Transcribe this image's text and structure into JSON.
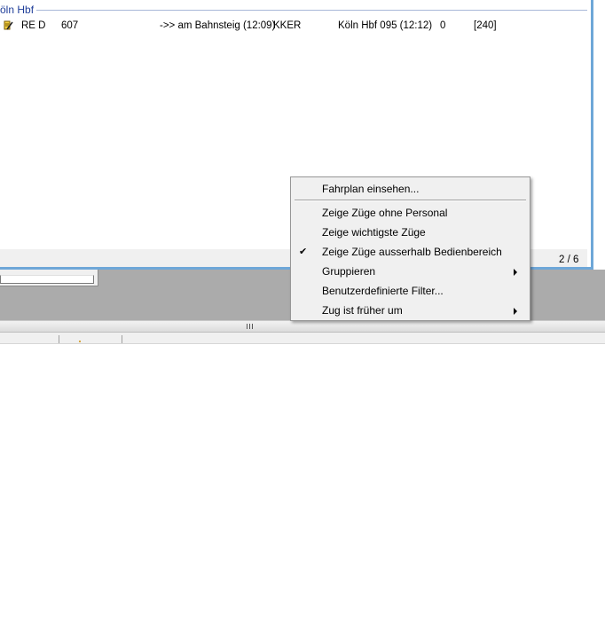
{
  "group": {
    "title": "öln Hbf"
  },
  "train_row": {
    "icon": "train-pencil-icon",
    "type": "RE D",
    "number": "607",
    "status": "->> am Bahnsteig (12:09)",
    "operator": "KKER",
    "destination": "Köln Hbf 095 (12:12)",
    "delay": "0",
    "track": "[240]"
  },
  "pager": {
    "text": "2 / 6"
  },
  "context_menu": {
    "items": [
      {
        "label": "Fahrplan einsehen...",
        "checked": false,
        "submenu": false
      },
      {
        "label": "Zeige Züge ohne Personal",
        "checked": false,
        "submenu": false
      },
      {
        "label": "Zeige wichtigste Züge",
        "checked": false,
        "submenu": false
      },
      {
        "label": "Zeige Züge ausserhalb Bedienbereich",
        "checked": true,
        "submenu": false
      },
      {
        "label": "Gruppieren",
        "checked": false,
        "submenu": true
      },
      {
        "label": "Benutzerdefinierte Filter...",
        "checked": false,
        "submenu": false
      },
      {
        "label": "Zug ist früher um",
        "checked": false,
        "submenu": true
      }
    ],
    "check_glyph": "✔"
  },
  "colors": {
    "panel_border": "#6ea7d8",
    "group_title": "#1f3e99",
    "work_area": "#ababab",
    "menu_bg": "#f0f0f0"
  }
}
